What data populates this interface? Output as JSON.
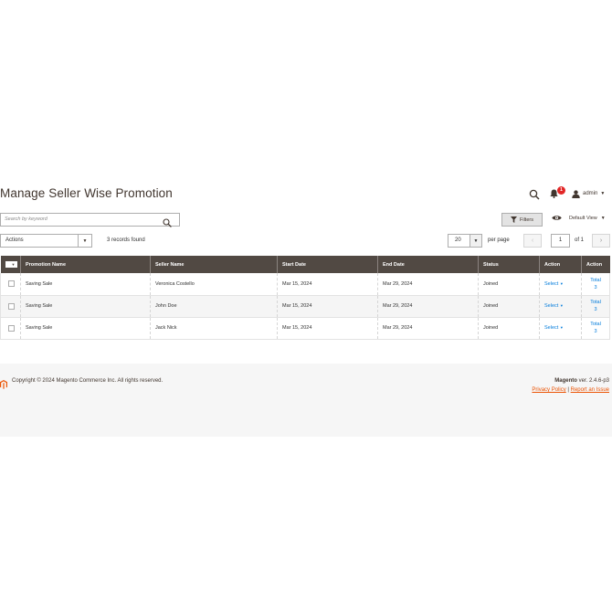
{
  "page": {
    "title": "Manage Seller Wise Promotion"
  },
  "header": {
    "notifications_count": "1",
    "user": "admin"
  },
  "search": {
    "placeholder": "Search by keyword"
  },
  "toolbar": {
    "filters_label": "Filters",
    "view_label": "Default View",
    "actions_label": "Actions",
    "records_found": "3 records found",
    "per_page_value": "20",
    "per_page_label": "per page",
    "page_current": "1",
    "page_of": "of 1"
  },
  "grid": {
    "columns": [
      "Promotion Name",
      "Seller Name",
      "Start Date",
      "End Date",
      "Status",
      "Action",
      "Action"
    ],
    "rows": [
      {
        "promotion": "Saving Sale",
        "seller": "Veronica Costello",
        "start": "Mar 15, 2024",
        "end": "Mar 29, 2024",
        "status": "Joined",
        "action": "Select",
        "total_label": "Total",
        "total_value": "3"
      },
      {
        "promotion": "Saving Sale",
        "seller": "John Doe",
        "start": "Mar 15, 2024",
        "end": "Mar 29, 2024",
        "status": "Joined",
        "action": "Select",
        "total_label": "Total",
        "total_value": "3"
      },
      {
        "promotion": "Saving Sale",
        "seller": "Jack Nick",
        "start": "Mar 15, 2024",
        "end": "Mar 29, 2024",
        "status": "Joined",
        "action": "Select",
        "total_label": "Total",
        "total_value": "3"
      }
    ]
  },
  "footer": {
    "copyright": "Copyright © 2024 Magento Commerce Inc. All rights reserved.",
    "brand": "Magento",
    "version": " ver. 2.4.6-p3",
    "privacy_link": "Privacy Policy",
    "separator": " | ",
    "report_link": "Report an Issue"
  },
  "colors": {
    "header_bg": "#514943",
    "link": "#007bdb",
    "accent": "#eb5202",
    "badge": "#e22626"
  }
}
